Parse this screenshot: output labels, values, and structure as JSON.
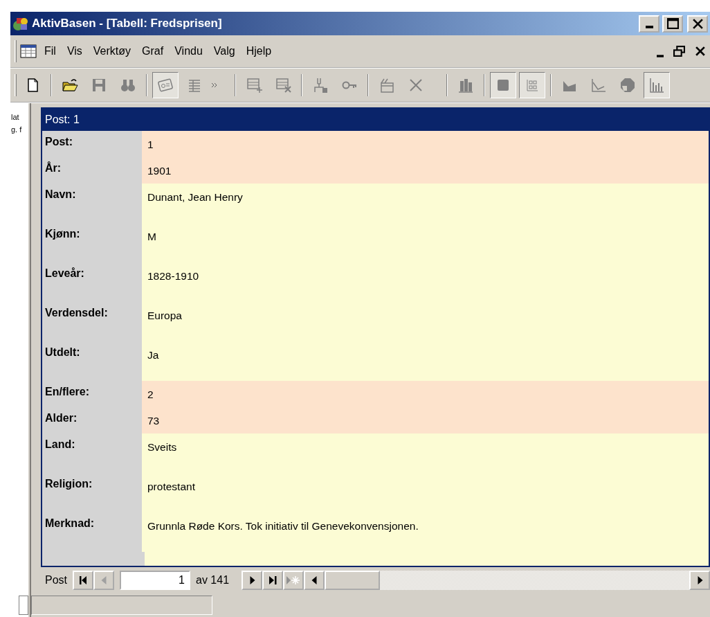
{
  "window": {
    "title": "AktivBasen - [Tabell: Fredsprisen]"
  },
  "menu": [
    {
      "label": "Fil"
    },
    {
      "label": "Vis"
    },
    {
      "label": "Verktøy"
    },
    {
      "label": "Graf"
    },
    {
      "label": "Vindu"
    },
    {
      "label": "Valg"
    },
    {
      "label": "Hjelp"
    }
  ],
  "toolbar": [
    {
      "kind": "new",
      "disabled": false,
      "pressed": false
    },
    {
      "kind": "sep"
    },
    {
      "kind": "open",
      "disabled": false,
      "pressed": false
    },
    {
      "kind": "save",
      "disabled": true,
      "pressed": false
    },
    {
      "kind": "find",
      "disabled": true,
      "pressed": false
    },
    {
      "kind": "sep"
    },
    {
      "kind": "form",
      "disabled": true,
      "pressed": true
    },
    {
      "kind": "table",
      "disabled": true,
      "pressed": false
    },
    {
      "kind": "more"
    },
    {
      "kind": "gap"
    },
    {
      "kind": "addrec",
      "disabled": true,
      "pressed": false
    },
    {
      "kind": "delrec",
      "disabled": true,
      "pressed": false
    },
    {
      "kind": "sep"
    },
    {
      "kind": "tree",
      "disabled": true,
      "pressed": false
    },
    {
      "kind": "key",
      "disabled": true,
      "pressed": false
    },
    {
      "kind": "sep"
    },
    {
      "kind": "clear",
      "disabled": true,
      "pressed": false
    },
    {
      "kind": "delete",
      "disabled": true,
      "pressed": false
    },
    {
      "kind": "gap"
    },
    {
      "kind": "bar3d",
      "disabled": true,
      "pressed": false
    },
    {
      "kind": "sep"
    },
    {
      "kind": "square",
      "disabled": true,
      "pressed": true
    },
    {
      "kind": "grid",
      "disabled": true,
      "pressed": true
    },
    {
      "kind": "sep"
    },
    {
      "kind": "area",
      "disabled": true,
      "pressed": false
    },
    {
      "kind": "line",
      "disabled": true,
      "pressed": false
    },
    {
      "kind": "pie",
      "disabled": true,
      "pressed": false
    },
    {
      "kind": "bars",
      "disabled": true,
      "pressed": true
    }
  ],
  "side_panel": {
    "lines": [
      "lat",
      "g. f"
    ]
  },
  "form": {
    "header": "Post: 1",
    "rows": [
      {
        "label": "Post:",
        "value": "1",
        "kind": "computed"
      },
      {
        "label": "År:",
        "value": "1901",
        "kind": "computed"
      },
      {
        "label": "Navn:",
        "value": "Dunant, Jean Henry",
        "kind": "field"
      },
      {
        "label": "Kjønn:",
        "value": "M",
        "kind": "field"
      },
      {
        "label": "Leveår:",
        "value": "1828-1910",
        "kind": "field"
      },
      {
        "label": "Verdensdel:",
        "value": "Europa",
        "kind": "field"
      },
      {
        "label": "Utdelt:",
        "value": "Ja",
        "kind": "field"
      },
      {
        "label": "En/flere:",
        "value": "2",
        "kind": "computed"
      },
      {
        "label": "Alder:",
        "value": "73",
        "kind": "computed"
      },
      {
        "label": "Land:",
        "value": "Sveits",
        "kind": "field"
      },
      {
        "label": "Religion:",
        "value": "protestant",
        "kind": "field"
      },
      {
        "label": "Merknad:",
        "value": "Grunnla Røde Kors. Tok initiativ til Genevekonvensjonen.",
        "kind": "field"
      }
    ]
  },
  "navigator": {
    "label": "Post",
    "record": "1",
    "total": "av 141",
    "first_disabled": false,
    "prev_disabled": true,
    "next_disabled": false,
    "last_disabled": false,
    "new_disabled": true
  }
}
